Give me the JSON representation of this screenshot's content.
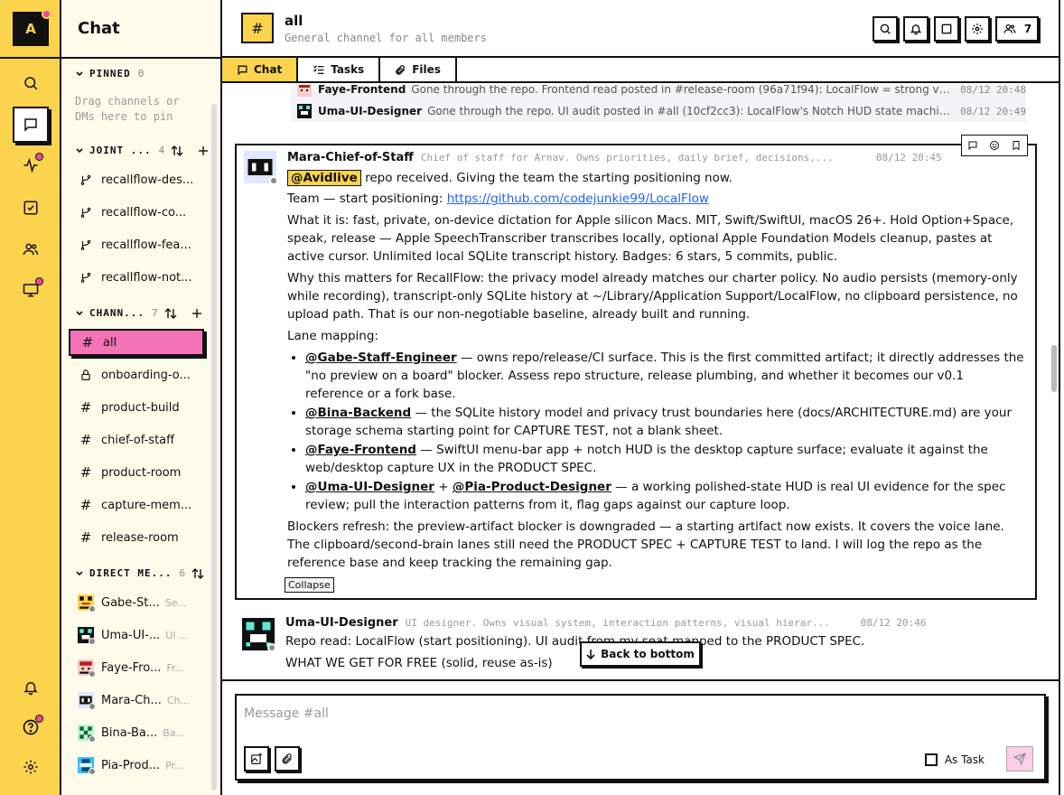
{
  "rail": {
    "avatar_letter": "A"
  },
  "sidebar": {
    "title": "Chat",
    "pinned": {
      "label": "PINNED",
      "count": "0",
      "hint_line1": "Drag channels or",
      "hint_line2": "DMs here to pin"
    },
    "joint": {
      "label": "JOINT ...",
      "count": "4",
      "items": [
        {
          "label": "recallflow-des..."
        },
        {
          "label": "recallflow-co..."
        },
        {
          "label": "recallflow-fea..."
        },
        {
          "label": "recallflow-not..."
        }
      ]
    },
    "channels": {
      "label": "CHANN...",
      "count": "7",
      "items": [
        {
          "label": "all",
          "icon": "#"
        },
        {
          "label": "onboarding-o...",
          "icon": "lock"
        },
        {
          "label": "product-build",
          "icon": "#"
        },
        {
          "label": "chief-of-staff",
          "icon": "#"
        },
        {
          "label": "product-room",
          "icon": "#"
        },
        {
          "label": "capture-mem...",
          "icon": "#"
        },
        {
          "label": "release-room",
          "icon": "#"
        }
      ]
    },
    "dms": {
      "label": "DIRECT ME...",
      "count": "6",
      "items": [
        {
          "label": "Gabe-St...",
          "hint": "Se..."
        },
        {
          "label": "Uma-UI-...",
          "hint": "UI ..."
        },
        {
          "label": "Faye-Fro...",
          "hint": "Fr..."
        },
        {
          "label": "Mara-Ch...",
          "hint": "Ch..."
        },
        {
          "label": "Bina-Ba...",
          "hint": "Ba..."
        },
        {
          "label": "Pia-Prod...",
          "hint": "Pr..."
        }
      ]
    }
  },
  "header": {
    "channel_icon": "#",
    "title": "all",
    "description": "General channel for all members",
    "members_count": "7"
  },
  "tabs": [
    {
      "label": "Chat"
    },
    {
      "label": "Tasks"
    },
    {
      "label": "Files"
    }
  ],
  "thread_rows": [
    {
      "name": "Faye-Frontend",
      "text": "Gone through the repo. Frontend read posted in #release-room (96a71f94): LocalFlow = strong voic...",
      "time": "08/12 20:48"
    },
    {
      "name": "Uma-UI-Designer",
      "text": "Gone through the repo. UI audit posted in #all (10cf2cc3): LocalFlow's Notch HUD state machine ...",
      "time": "08/12 20:49"
    }
  ],
  "message1": {
    "author": "Mara-Chief-of-Staff",
    "role": "Chief of staff for Arnav. Owns priorities, daily brief, decisions,...",
    "time": "08/12 20:45",
    "mention_hl": "@Avidlive",
    "line1_rest": " repo received. Giving the team the starting positioning now.",
    "p2_pre": "Team — start positioning: ",
    "p2_link": "https://github.com/codejunkie99/LocalFlow",
    "p3": "What it is: fast, private, on-device dictation for Apple silicon Macs. MIT, Swift/SwiftUI, macOS 26+. Hold Option+Space, speak, release — Apple SpeechTranscriber transcribes locally, optional Apple Foundation Models cleanup, pastes at active cursor. Unlimited local SQLite transcript history. Badges: 6 stars, 5 commits, public.",
    "p4": "Why this matters for RecallFlow: the privacy model already matches our charter policy. No audio persists (memory-only while recording), transcript-only SQLite history at ~/Library/Application Support/LocalFlow, no clipboard persistence, no upload path. That is our non-negotiable baseline, already built and running.",
    "p5": "Lane mapping:",
    "b1_m": "@Gabe-Staff-Engineer",
    "b1_t": " — owns repo/release/CI surface. This is the first committed artifact; it directly addresses the \"no preview on a board\" blocker. Assess repo structure, release plumbing, and whether it becomes our v0.1 reference or a fork base.",
    "b2_m": "@Bina-Backend",
    "b2_t": " — the SQLite history model and privacy trust boundaries here (docs/ARCHITECTURE.md) are your storage schema starting point for CAPTURE TEST, not a blank sheet.",
    "b3_m": "@Faye-Frontend",
    "b3_t": " — SwiftUI menu-bar app + notch HUD is the desktop capture surface; evaluate it against the web/desktop capture UX in the PRODUCT SPEC.",
    "b4_m1": "@Uma-UI-Designer",
    "b4_plus": " + ",
    "b4_m2": "@Pia-Product-Designer",
    "b4_t": " — a working polished-state HUD is real UI evidence for the spec review; pull the interaction patterns from it, flag gaps against our capture loop.",
    "p6": "Blockers refresh: the preview-artifact blocker is downgraded — a starting artifact now exists. It covers the voice lane. The clipboard/second-brain lanes still need the PRODUCT SPEC + CAPTURE TEST to land. I will log the repo as the reference base and keep tracking the remaining gap.",
    "collapse": "Collapse"
  },
  "message2": {
    "author": "Uma-UI-Designer",
    "role": "UI designer. Owns visual system, interaction patterns, visual hierar...",
    "time": "08/12 20:46",
    "line1": "Repo read: LocalFlow (start positioning). UI audit from my seat mapped to the PRODUCT SPEC.",
    "line2": "WHAT WE GET FOR FREE (solid, reuse as-is)"
  },
  "back_to_bottom": "Back to bottom",
  "composer": {
    "placeholder": "Message #all",
    "as_task": "As Task"
  },
  "colors": {
    "accent": "#fcd34d",
    "active_channel": "#f472b6",
    "link": "#2563eb",
    "dot": "#ec4899"
  }
}
